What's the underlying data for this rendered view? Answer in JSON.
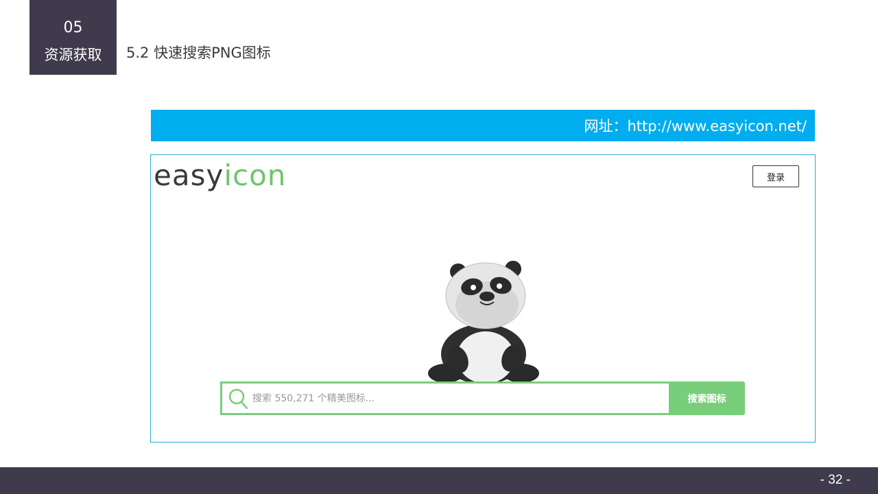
{
  "section": {
    "number": "05",
    "name": "资源获取"
  },
  "slide_title": "5.2 快速搜索PNG图标",
  "url_banner": "网址：http://www.easyicon.net/",
  "site": {
    "logo_part1": "easy",
    "logo_part2": "icon",
    "login_label": "登录",
    "search": {
      "placeholder": "搜索 550,271 个精美图标...",
      "value": "",
      "button_label": "搜索图标"
    },
    "mascot": "panda-mascot"
  },
  "colors": {
    "section_bg": "#3f3b4c",
    "banner_blue": "#00adee",
    "frame_border": "#29a9d6",
    "accent_green": "#78ce7a"
  },
  "footer": {
    "page_number": "- 32 -"
  }
}
